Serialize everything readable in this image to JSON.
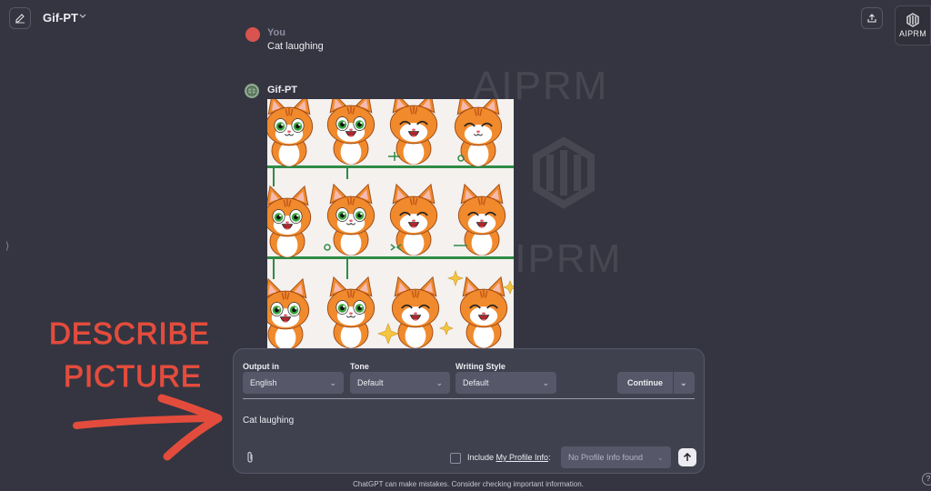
{
  "header": {
    "model_name": "Gif-PT",
    "aiprm_label": "AIPRM"
  },
  "watermark": {
    "line1": "AIPRM",
    "line2": "AIPRM"
  },
  "conversation": {
    "user_name": "You",
    "user_message": "Cat laughing",
    "assistant_name": "Gif-PT",
    "image_description": "Grid of cartoon orange cat expressions (sprite sheet)"
  },
  "annotation": {
    "line1": "DESCRIBE",
    "line2": "PICTURE"
  },
  "composer": {
    "output_label": "Output in",
    "output_value": "English",
    "tone_label": "Tone",
    "tone_value": "Default",
    "style_label": "Writing Style",
    "style_value": "Default",
    "continue_label": "Continue",
    "prompt_value": "Cat laughing",
    "include_prefix": "Include ",
    "profile_link": "My Profile Info",
    "include_suffix": ":",
    "profile_select": "No Profile Info found"
  },
  "footer": {
    "disclaimer": "ChatGPT can make mistakes. Consider checking important information.",
    "help": "?"
  },
  "colors": {
    "background": "#343541",
    "composer": "#40414f",
    "annotation": "#e34c3c",
    "cat_orange": "#f08a2c"
  },
  "icons": [
    "edit-icon",
    "chevron-down-icon",
    "share-icon",
    "aiprm-logo-icon",
    "sidebar-toggle-icon",
    "attach-icon",
    "send-arrow-icon"
  ]
}
